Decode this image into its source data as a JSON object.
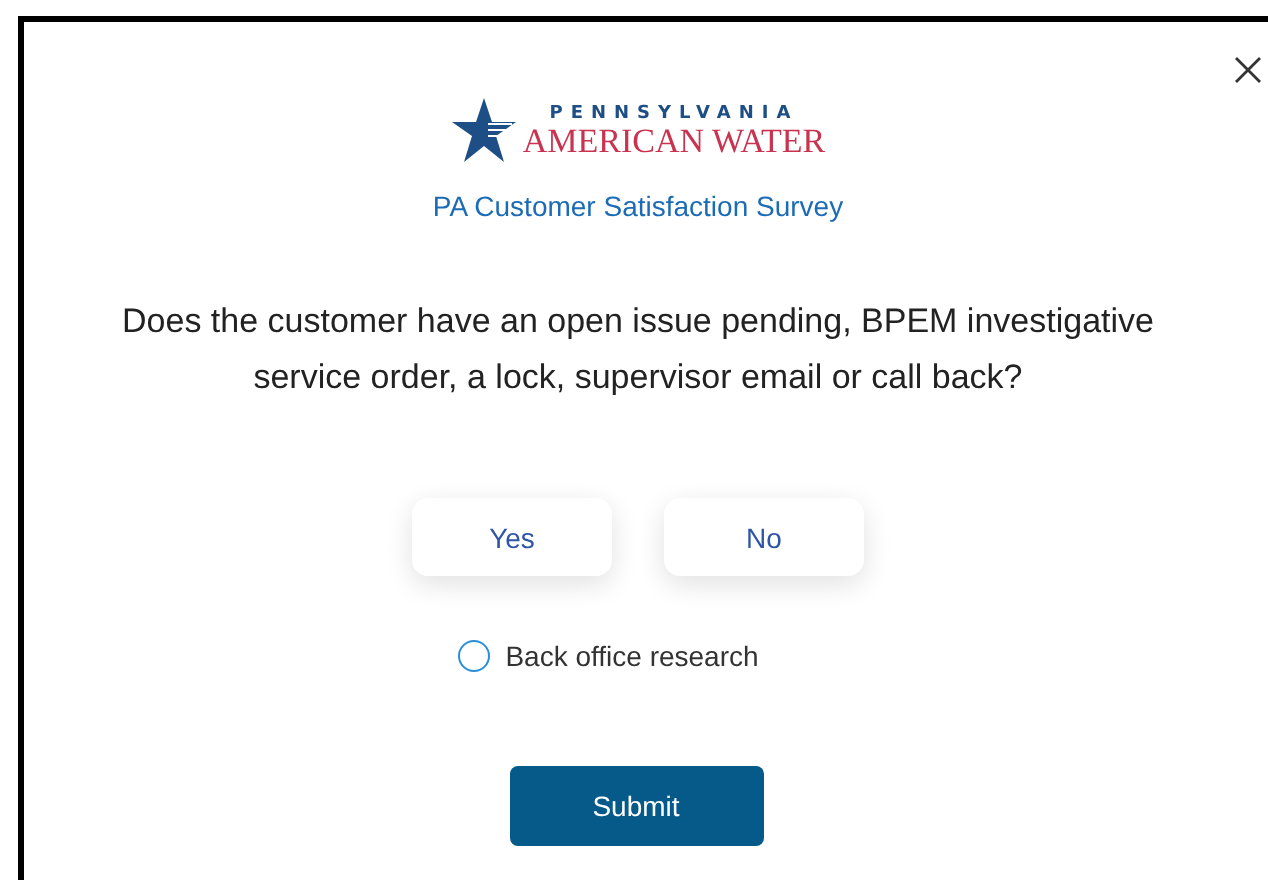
{
  "logo": {
    "top_line": "PENNSYLVANIA",
    "bottom_line": "AMERICAN WATER"
  },
  "survey_title": "PA Customer Satisfaction Survey",
  "question": "Does the customer have an open issue pending, BPEM investigative service order, a lock, supervisor email or call back?",
  "answers": [
    {
      "label": "Yes",
      "selected": false
    },
    {
      "label": "No",
      "selected": false
    }
  ],
  "option": {
    "label": "Back office research",
    "checked": false
  },
  "submit": "Submit"
}
